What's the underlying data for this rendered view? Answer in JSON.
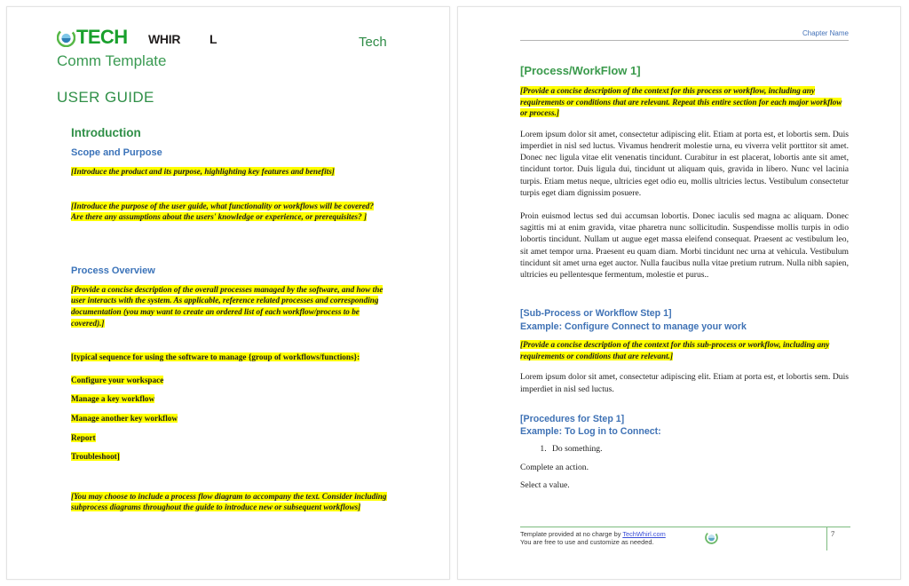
{
  "document": {
    "left_page": {
      "brand": {
        "logo_icon": "techwhirl-swirl-logo",
        "tech": "TECH",
        "whirl": "WHIR",
        "whirl_tail": "L",
        "header_right": "Tech",
        "subtitle": "Comm Template"
      },
      "doc_type": "USER GUIDE",
      "heading_introduction": "Introduction",
      "heading_scope": "Scope and Purpose",
      "note_product": "[Introduce the product and its purpose, highlighting key features and benefits]",
      "note_purpose": "[Introduce the purpose of the user guide, what functionality or workflows will be covered? Are there any assumptions about the users' knowledge or experience, or prerequisites? ]",
      "heading_process_overview": "Process Overview",
      "note_process": "[Provide a concise description of the overall processes managed by the software, and how the user interacts with the system. As applicable, reference related processes and corresponding documentation (you may want to create an ordered list of each workflow/process to be covered).]",
      "note_sequence": "[typical sequence for using the software to manage  {group of workflows/functions}:",
      "workflow_items": [
        "Configure your workspace",
        "Manage a key workflow",
        "Manage another key workflow",
        "Report",
        "Troubleshoot]"
      ],
      "note_diagram": "[You may choose to include a process flow diagram to accompany the text. Consider including subprocess diagrams throughout the guide to introduce new or subsequent workflows]"
    },
    "right_page": {
      "chapter_name": "Chapter Name",
      "heading_process": "[Process/WorkFlow 1]",
      "note_context": "[Provide a concise description of the context for this process or workflow, including any requirements or conditions that are relevant. Repeat this entire section for each major workflow or process.]",
      "paragraph_1": "Lorem ipsum dolor sit amet, consectetur adipiscing elit. Etiam at porta est, et lobortis sem. Duis imperdiet in nisl sed luctus. Vivamus hendrerit molestie urna, eu viverra velit porttitor sit amet. Donec nec ligula vitae elit venenatis tincidunt. Curabitur in est placerat, lobortis ante sit amet, tincidunt tortor. Duis ligula dui, tincidunt ut aliquam quis, gravida in libero. Nunc vel lacinia turpis. Etiam metus neque, ultricies eget odio eu, mollis ultricies lectus. Vestibulum consectetur turpis eget diam dignissim posuere.",
      "paragraph_2": "Proin euismod lectus sed dui accumsan lobortis. Donec iaculis sed magna ac aliquam. Donec sagittis mi at enim gravida, vitae pharetra nunc sollicitudin. Suspendisse mollis turpis in odio lobortis tincidunt. Nullam ut augue eget massa eleifend consequat. Praesent ac vestibulum leo, sit amet tempor urna. Praesent eu quam diam. Morbi tincidunt nec urna at vehicula. Vestibulum tincidunt sit amet urna eget auctor. Nulla faucibus nulla vitae pretium rutrum. Nulla nibh sapien, ultricies eu pellentesque fermentum, molestie et purus..",
      "heading_subprocess_line1": "[Sub-Process or Workflow Step 1]",
      "heading_subprocess_line2": "Example: Configure Connect to manage your work",
      "note_subprocess": "[Provide a concise description of the context for this sub-process or workflow, including any requirements or conditions that are relevant.]",
      "paragraph_3": "Lorem ipsum dolor sit amet, consectetur adipiscing elit. Etiam at porta est, et lobortis sem. Duis imperdiet in nisl sed luctus.",
      "heading_procedures_line1": "[Procedures for Step 1]",
      "heading_procedures_line2": "Example: To Log in to Connect:",
      "numbered_steps": [
        "Do something."
      ],
      "plain_steps": [
        "Complete an action.",
        "Select a value."
      ],
      "footer": {
        "line1_prefix": "Template provided at no charge by ",
        "line1_link": "TechWhirl.com",
        "line2": "You are free to use and customize as needed.",
        "logo_icon": "techwhirl-swirl-logo",
        "page_number": "7"
      }
    }
  },
  "colors": {
    "brand_green": "#19a02c",
    "heading_green": "#2f8f47",
    "heading_blue": "#3b73b9",
    "highlight_yellow": "#ffff00",
    "link_blue": "#3b4fd8",
    "footer_rule_green": "#7dbb7f"
  }
}
